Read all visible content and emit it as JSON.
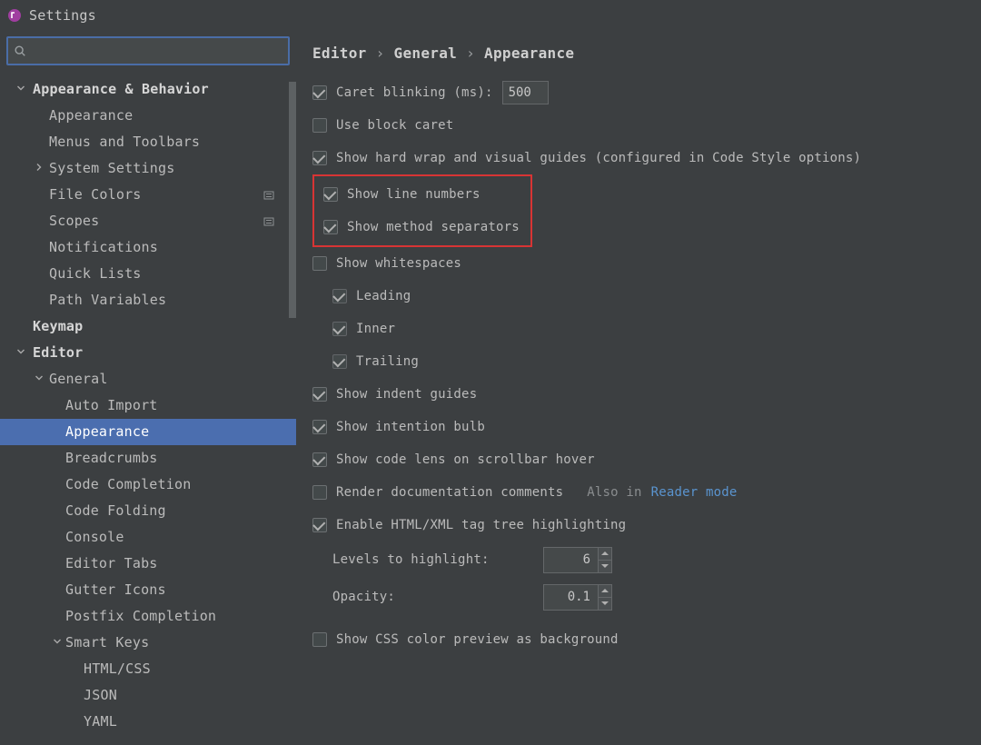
{
  "window_title": "Settings",
  "search_placeholder": "",
  "sidebar": {
    "items": [
      {
        "label": "Appearance & Behavior"
      },
      {
        "label": "Appearance"
      },
      {
        "label": "Menus and Toolbars"
      },
      {
        "label": "System Settings"
      },
      {
        "label": "File Colors"
      },
      {
        "label": "Scopes"
      },
      {
        "label": "Notifications"
      },
      {
        "label": "Quick Lists"
      },
      {
        "label": "Path Variables"
      },
      {
        "label": "Keymap"
      },
      {
        "label": "Editor"
      },
      {
        "label": "General"
      },
      {
        "label": "Auto Import"
      },
      {
        "label": "Appearance"
      },
      {
        "label": "Breadcrumbs"
      },
      {
        "label": "Code Completion"
      },
      {
        "label": "Code Folding"
      },
      {
        "label": "Console"
      },
      {
        "label": "Editor Tabs"
      },
      {
        "label": "Gutter Icons"
      },
      {
        "label": "Postfix Completion"
      },
      {
        "label": "Smart Keys"
      },
      {
        "label": "HTML/CSS"
      },
      {
        "label": "JSON"
      },
      {
        "label": "YAML"
      }
    ]
  },
  "breadcrumbs": [
    "Editor",
    "General",
    "Appearance"
  ],
  "settings": {
    "caret_blinking": {
      "label": "Caret blinking (ms):",
      "value": "500"
    },
    "use_block_caret": "Use block caret",
    "show_hard_wrap": "Show hard wrap and visual guides (configured in Code Style options)",
    "show_line_numbers": "Show line numbers",
    "show_method_separators": "Show method separators",
    "show_whitespaces": "Show whitespaces",
    "ws_leading": "Leading",
    "ws_inner": "Inner",
    "ws_trailing": "Trailing",
    "show_indent_guides": "Show indent guides",
    "show_intention_bulb": "Show intention bulb",
    "show_code_lens": "Show code lens on scrollbar hover",
    "render_doc_comments": "Render documentation comments",
    "also_in": "Also in",
    "reader_mode": "Reader mode",
    "enable_html_tag_tree": "Enable HTML/XML tag tree highlighting",
    "levels_to_highlight": {
      "label": "Levels to highlight:",
      "value": "6"
    },
    "opacity": {
      "label": "Opacity:",
      "value": "0.1"
    },
    "show_css_color_preview": "Show CSS color preview as background"
  }
}
